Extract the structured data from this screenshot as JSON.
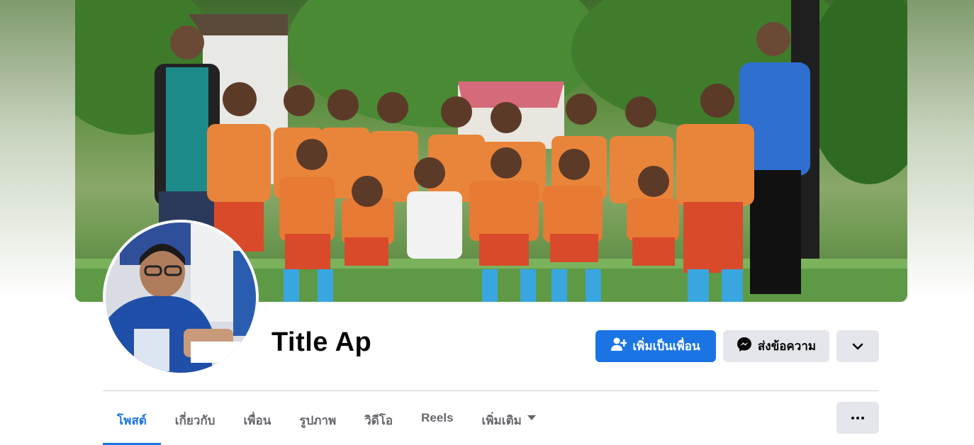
{
  "profile": {
    "name": "Title Ap"
  },
  "actions": {
    "add_friend_label": "เพิ่มเป็นเพื่อน",
    "message_label": "ส่งข้อความ",
    "add_friend_icon": "person-plus-icon",
    "message_icon": "messenger-icon",
    "expand_icon": "chevron-down-icon"
  },
  "tabs": [
    {
      "label": "โพสต์",
      "active": true
    },
    {
      "label": "เกี่ยวกับ"
    },
    {
      "label": "เพื่อน"
    },
    {
      "label": "รูปภาพ"
    },
    {
      "label": "วิดีโอ"
    },
    {
      "label": "Reels"
    },
    {
      "label": "เพิ่มเติม"
    }
  ],
  "menu": {
    "icon": "ellipsis-icon"
  },
  "colors": {
    "accent": "#1b74e4",
    "button_secondary": "#e4e6eb",
    "text_primary": "#050505",
    "text_secondary": "#65676b"
  }
}
